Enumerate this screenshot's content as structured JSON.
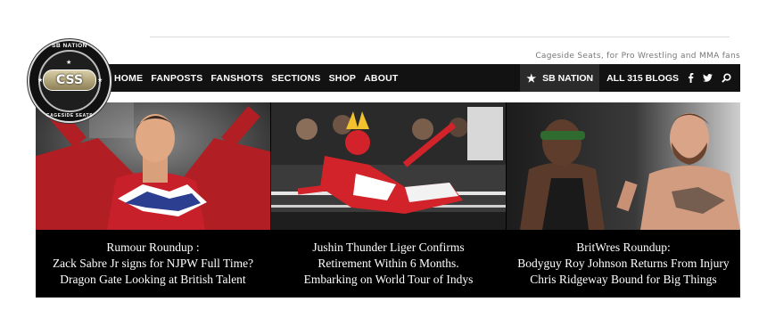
{
  "site": {
    "logo_top": "SB NATION",
    "logo_badge": "CSS",
    "logo_bottom": "CAGESIDE SEATS",
    "tagline": "Cageside Seats, for Pro Wrestling and MMA fans"
  },
  "nav": {
    "items": [
      "HOME",
      "FANPOSTS",
      "FANSHOTS",
      "SECTIONS",
      "SHOP",
      "ABOUT"
    ],
    "sb_nation_label": "SB NATION",
    "blogs_label": "ALL 315 BLOGS",
    "icons": [
      "star-icon",
      "facebook-icon",
      "twitter-icon",
      "search-icon"
    ]
  },
  "cards": [
    {
      "image": "wrestler-red-jacket-photo",
      "lines": [
        "Rumour Roundup :",
        "Zack Sabre Jr signs for NJPW Full Time?",
        "Dragon Gate Looking at British Talent"
      ]
    },
    {
      "image": "masked-wrestler-ring-photo",
      "lines": [
        "Jushin Thunder Liger Confirms",
        "Retirement Within 6 Months.",
        "Embarking on World Tour of Indys"
      ]
    },
    {
      "image": "two-wrestlers-portrait-photo",
      "lines": [
        "BritWres Roundup:",
        "Bodyguy Roy Johnson Returns From Injury",
        "Chris Ridgeway Bound for Big Things"
      ]
    }
  ],
  "colors": {
    "nav_bg": "#121212",
    "sb_box_bg": "#2b2b2b",
    "caption_bg": "#000000",
    "accent_red": "#c8202a"
  }
}
